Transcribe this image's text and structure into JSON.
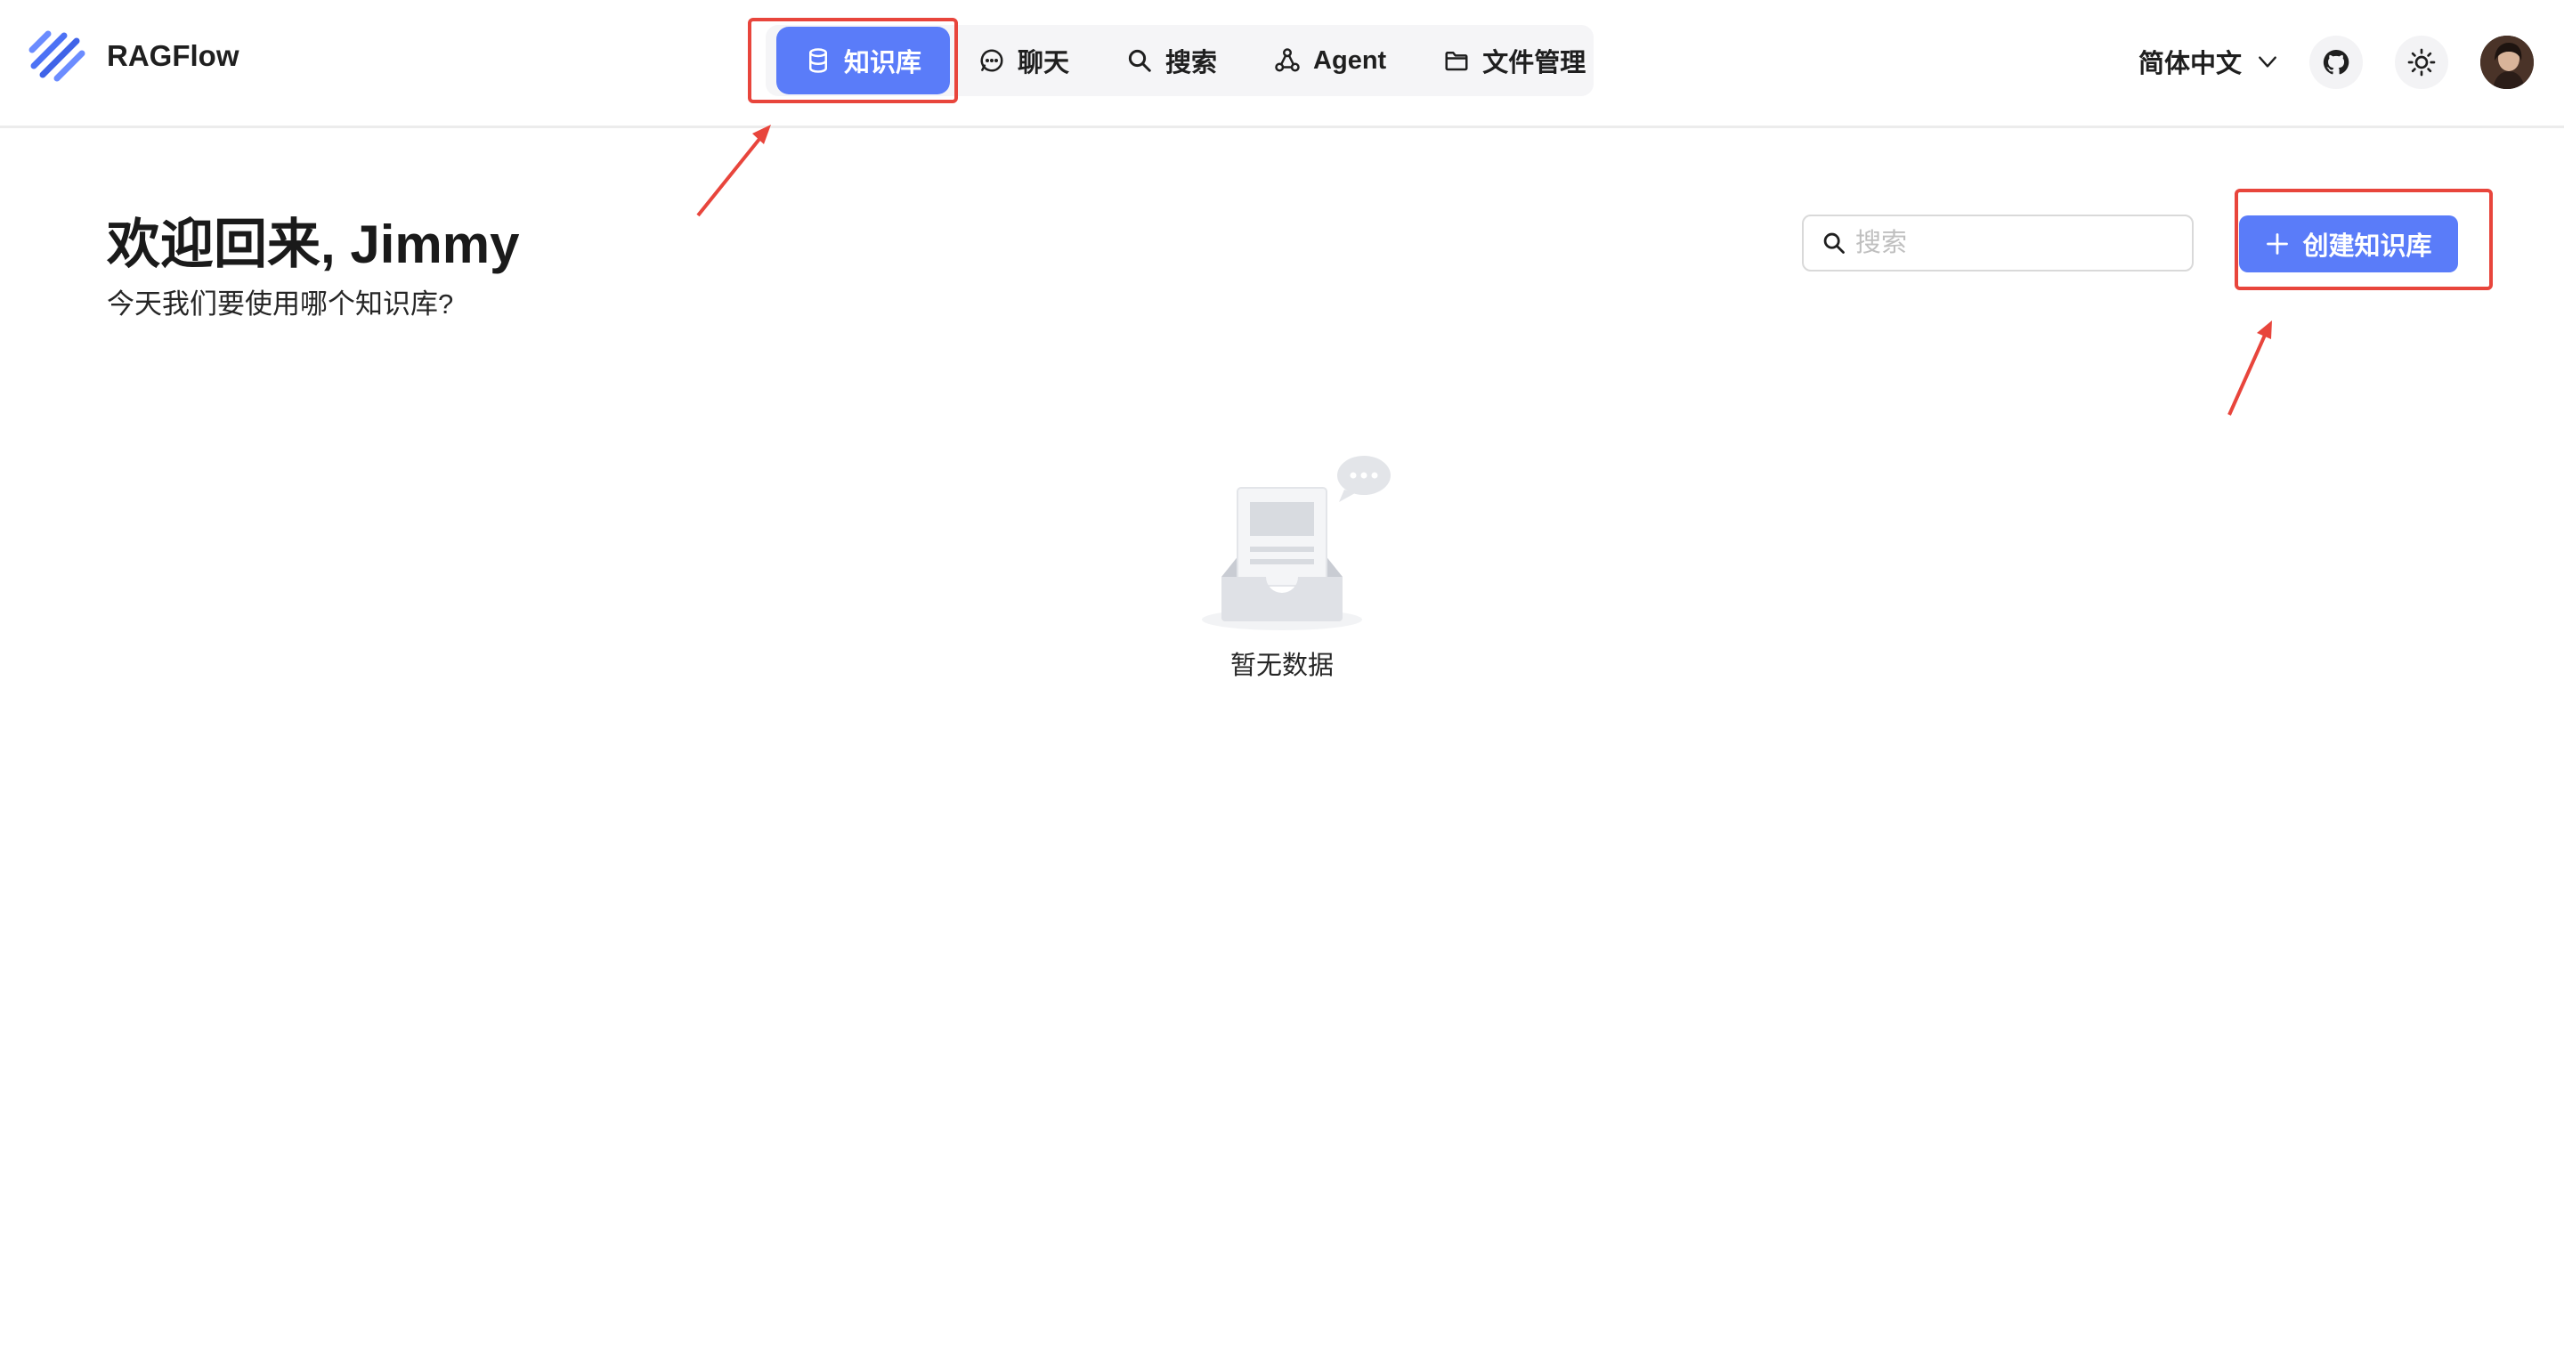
{
  "app": {
    "brand": "RAGFlow"
  },
  "nav": {
    "items": [
      {
        "label": "知识库",
        "icon": "database-icon",
        "active": true
      },
      {
        "label": "聊天",
        "icon": "chat-bubble-icon",
        "active": false
      },
      {
        "label": "搜索",
        "icon": "search-icon",
        "active": false
      },
      {
        "label": "Agent",
        "icon": "agent-graph-icon",
        "active": false
      },
      {
        "label": "文件管理",
        "icon": "folder-icon",
        "active": false
      }
    ],
    "active_color": "#5a7cf9"
  },
  "header_right": {
    "language": "简体中文",
    "github_icon": "github-icon",
    "theme_icon": "sun-icon",
    "avatar": "user-avatar"
  },
  "main": {
    "welcome": "欢迎回来, Jimmy",
    "subtitle": "今天我们要使用哪个知识库?",
    "search_placeholder": "搜索",
    "create_button": "创建知识库",
    "empty_text": "暂无数据"
  },
  "annotations": {
    "highlight_color": "#e8453c"
  }
}
